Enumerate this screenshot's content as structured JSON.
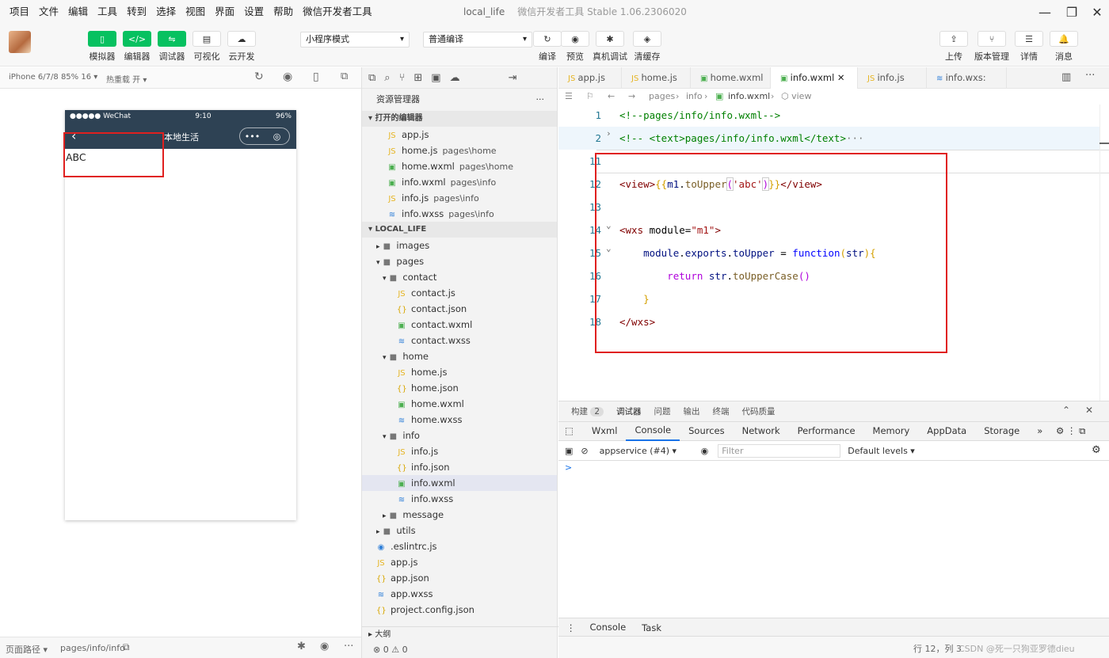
{
  "menu": [
    "项目",
    "文件",
    "编辑",
    "工具",
    "转到",
    "选择",
    "视图",
    "界面",
    "设置",
    "帮助",
    "微信开发者工具"
  ],
  "window": {
    "project": "local_life",
    "title": "微信开发者工具 Stable 1.06.2306020"
  },
  "toolbar": {
    "left": [
      {
        "label": "模拟器",
        "icon": "▯"
      },
      {
        "label": "编辑器",
        "icon": "</>"
      },
      {
        "label": "调试器",
        "icon": "⇋"
      },
      {
        "label": "可视化",
        "icon": "▤"
      },
      {
        "label": "云开发",
        "icon": "☁"
      }
    ],
    "mode": "小程序模式",
    "compile": "普通编译",
    "mid": [
      {
        "label": "编译",
        "icon": "↻"
      },
      {
        "label": "预览",
        "icon": "◉"
      },
      {
        "label": "真机调试",
        "icon": "✱"
      },
      {
        "label": "清缓存",
        "icon": "◈"
      }
    ],
    "right": [
      {
        "label": "上传",
        "icon": "⇪"
      },
      {
        "label": "版本管理",
        "icon": "⑂"
      },
      {
        "label": "详情",
        "icon": "☰"
      },
      {
        "label": "消息",
        "icon": "🔔"
      }
    ]
  },
  "sim": {
    "device": "iPhone 6/7/8 85% 16 ▾",
    "hotreload": "热重载 开 ▾",
    "carrier": "●●●●● WeChat",
    "time": "9:10",
    "battery": "96%",
    "navtitle": "本地生活",
    "content": "ABC",
    "path_label": "页面路径 ▾",
    "path": "pages/info/info"
  },
  "explorer": {
    "title": "资源管理器",
    "open_section": "打开的编辑器",
    "open": [
      {
        "name": "app.js",
        "sub": "",
        "t": "js"
      },
      {
        "name": "home.js",
        "sub": "pages\\home",
        "t": "js"
      },
      {
        "name": "home.wxml",
        "sub": "pages\\home",
        "t": "wx"
      },
      {
        "name": "info.wxml",
        "sub": "pages\\info",
        "t": "wx"
      },
      {
        "name": "info.js",
        "sub": "pages\\info",
        "t": "js"
      },
      {
        "name": "info.wxss",
        "sub": "pages\\info",
        "t": "css"
      }
    ],
    "proj_section": "LOCAL_LIFE",
    "tree": [
      {
        "name": "images",
        "d": 1,
        "t": "dir",
        "a": "▸"
      },
      {
        "name": "pages",
        "d": 1,
        "t": "dir",
        "a": "▾"
      },
      {
        "name": "contact",
        "d": 2,
        "t": "dir",
        "a": "▾"
      },
      {
        "name": "contact.js",
        "d": 3,
        "t": "js"
      },
      {
        "name": "contact.json",
        "d": 3,
        "t": "json"
      },
      {
        "name": "contact.wxml",
        "d": 3,
        "t": "wx"
      },
      {
        "name": "contact.wxss",
        "d": 3,
        "t": "css"
      },
      {
        "name": "home",
        "d": 2,
        "t": "dir",
        "a": "▾"
      },
      {
        "name": "home.js",
        "d": 3,
        "t": "js"
      },
      {
        "name": "home.json",
        "d": 3,
        "t": "json"
      },
      {
        "name": "home.wxml",
        "d": 3,
        "t": "wx"
      },
      {
        "name": "home.wxss",
        "d": 3,
        "t": "css"
      },
      {
        "name": "info",
        "d": 2,
        "t": "dir",
        "a": "▾"
      },
      {
        "name": "info.js",
        "d": 3,
        "t": "js"
      },
      {
        "name": "info.json",
        "d": 3,
        "t": "json"
      },
      {
        "name": "info.wxml",
        "d": 3,
        "t": "wx",
        "active": true
      },
      {
        "name": "info.wxss",
        "d": 3,
        "t": "css"
      },
      {
        "name": "message",
        "d": 2,
        "t": "dir",
        "a": "▸"
      },
      {
        "name": "utils",
        "d": 1,
        "t": "dir",
        "a": "▸"
      },
      {
        "name": ".eslintrc.js",
        "d": 1,
        "t": "cfg"
      },
      {
        "name": "app.js",
        "d": 1,
        "t": "js"
      },
      {
        "name": "app.json",
        "d": 1,
        "t": "json"
      },
      {
        "name": "app.wxss",
        "d": 1,
        "t": "css"
      },
      {
        "name": "project.config.json",
        "d": 1,
        "t": "json"
      }
    ],
    "outline": "大纲",
    "errors": "⊗ 0 ⚠ 0"
  },
  "tabs": [
    {
      "name": "app.js",
      "t": "js"
    },
    {
      "name": "home.js",
      "t": "js"
    },
    {
      "name": "home.wxml",
      "t": "wx"
    },
    {
      "name": "info.wxml",
      "t": "wx",
      "active": true
    },
    {
      "name": "info.js",
      "t": "js"
    },
    {
      "name": "info.wxs:",
      "t": "css"
    }
  ],
  "breadcrumb": [
    "pages",
    "info",
    "info.wxml",
    "view"
  ],
  "code": {
    "lines": [
      "1",
      "2",
      "11",
      "12",
      "13",
      "14",
      "15",
      "16",
      "17",
      "18"
    ]
  },
  "devtools": {
    "top": [
      "构建",
      "2",
      "调试器",
      "问题",
      "输出",
      "终端",
      "代码质量"
    ],
    "tabs": [
      "Wxml",
      "Console",
      "Sources",
      "Network",
      "Performance",
      "Memory",
      "AppData",
      "Storage",
      "»"
    ],
    "context": "appservice (#4)",
    "filter": "Filter",
    "levels": "Default levels ▾",
    "prompt": ">",
    "bottom": [
      "Console",
      "Task"
    ]
  },
  "statusbar": {
    "pos": "行 12，列 3",
    "watermark": "CSDN @死一只狗亚罗德dieu"
  }
}
